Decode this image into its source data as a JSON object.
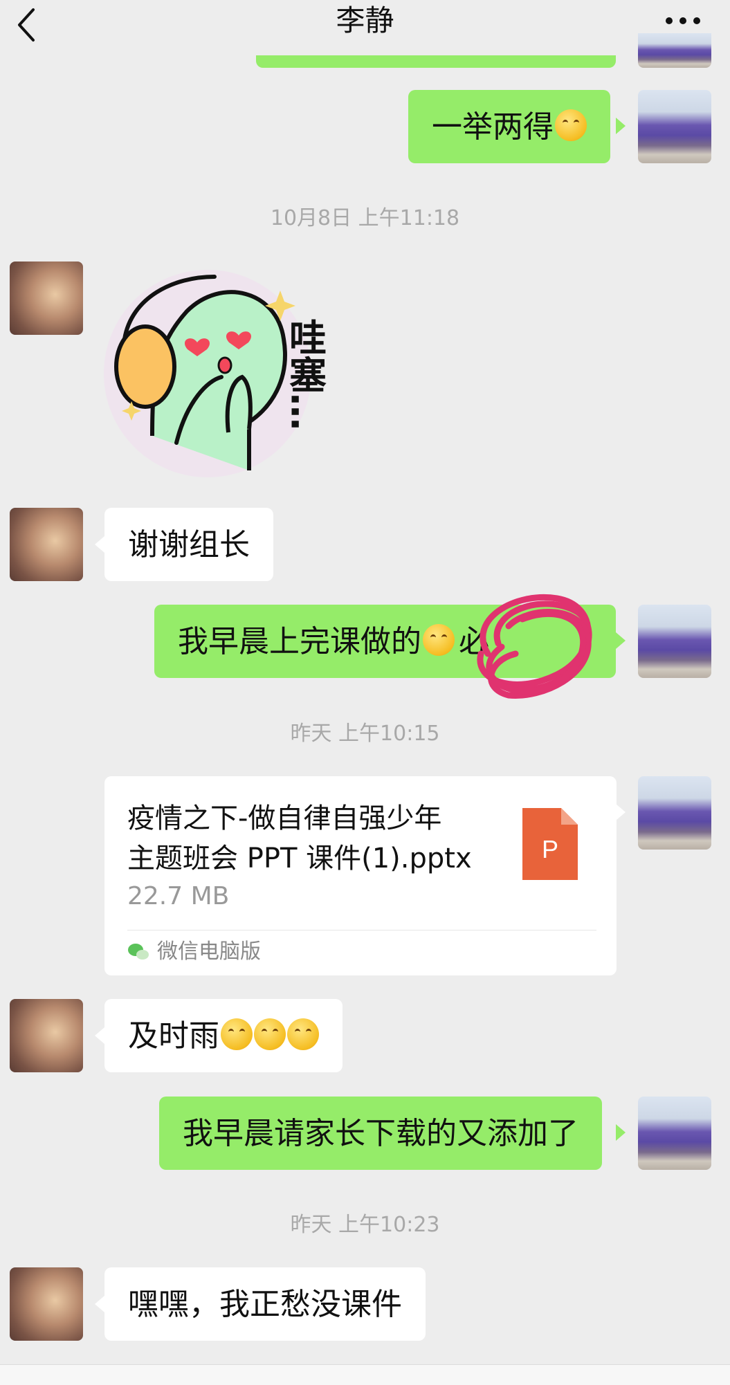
{
  "header": {
    "title": "李静"
  },
  "messages": {
    "m1_text": "一举两得",
    "time1": "10月8日 上午11:18",
    "sticker_text": "哇塞…",
    "m2_text": "谢谢组长",
    "m3_text": "我早晨上完课做的",
    "m3_obscured": "必",
    "time2": "昨天 上午10:15",
    "file": {
      "name_line1": "疫情之下-做自律自强少年",
      "name_line2": "主题班会 PPT 课件(1).pptx",
      "size": "22.7 MB",
      "source": "微信电脑版",
      "icon_letter": "P"
    },
    "m4_text": "及时雨",
    "m5_text": "我早晨请家长下载的又添加了",
    "time3": "昨天 上午10:23",
    "m6_text": "嘿嘿，我正愁没课件"
  },
  "colors": {
    "self_bubble": "#95ec69",
    "other_bubble": "#ffffff",
    "background": "#ededed",
    "ppt_icon": "#e8633a",
    "scribble": "#e0336f"
  },
  "icons": [
    "back-chevron-icon",
    "more-dots-icon",
    "wechat-icon",
    "ppt-file-icon"
  ]
}
